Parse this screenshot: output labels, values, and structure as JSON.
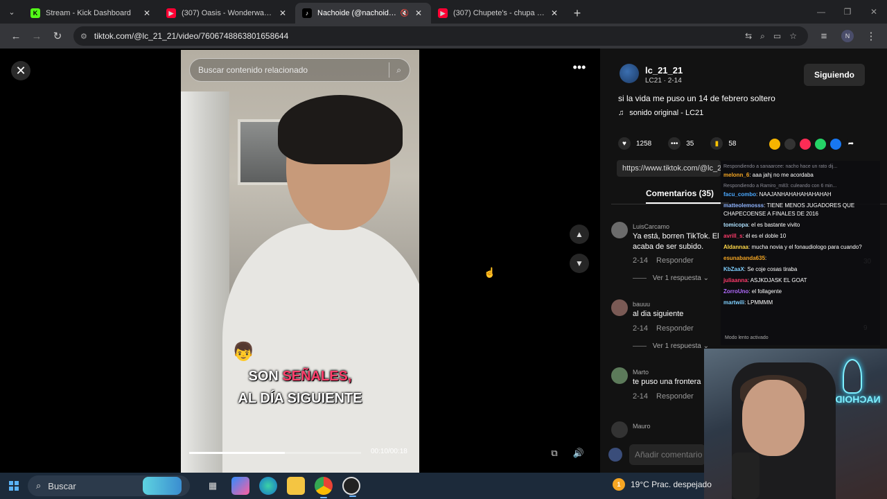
{
  "browser": {
    "tabs": [
      {
        "title": "Stream - Kick Dashboard",
        "favicon": "kick-icon",
        "color": "#53fc18",
        "active": false
      },
      {
        "title": "(307) Oasis - Wonderwall (Lyrics)",
        "favicon": "youtube-icon",
        "color": "#ff0033",
        "active": false
      },
      {
        "title": "Nachoide (@nachoide1) | TikTok",
        "favicon": "tiktok-icon",
        "color": "#000000",
        "active": true
      },
      {
        "title": "(307) Chupete's - chupa chupa chupa",
        "favicon": "youtube-icon",
        "color": "#ff0033",
        "active": false
      }
    ],
    "url": "tiktok.com/@lc_21_21/video/7606748863801658644",
    "profile_initial": "N"
  },
  "video": {
    "search_placeholder": "Buscar contenido relacionado",
    "caption_line1_a": "SON ",
    "caption_line1_b": "SEÑALES,",
    "caption_line2": "AL DÍA SIGUIENTE",
    "time": "00:10/00:18",
    "progress": 0.556
  },
  "post": {
    "username": "lc_21_21",
    "subtitle": "LC21 · 2-14",
    "follow_label": "Siguiendo",
    "description": "si la vida me puso un 14 de febrero soltero",
    "sound": "sonido original - LC21",
    "likes": "1258",
    "comments": "35",
    "saves": "58",
    "share_url": "https://www.tiktok.com/@lc_2",
    "comments_tab": "Comentarios (35)"
  },
  "comments": [
    {
      "user": "LuisCarcamo",
      "text": "Ya está, borren TikTok. El acaba de ser subido.",
      "date": "2-14",
      "reply": "Responder",
      "view_replies": "Ver 1 respuesta"
    },
    {
      "user": "bauuu",
      "text": "al dia siguiente",
      "date": "2-14",
      "reply": "Responder",
      "view_replies": "Ver 1 respuesta"
    },
    {
      "user": "Marto",
      "text": "te puso una frontera",
      "date": "2-14",
      "reply": "Responder"
    },
    {
      "user": "Mauro"
    }
  ],
  "side_numbers": [
    "30",
    "9"
  ],
  "add_comment_placeholder": "Añadir comentario",
  "chat": {
    "messages": [
      {
        "meta": "Respondiendo a sanaarcee: nacho hace un rato dij...",
        "user": "melonn_6",
        "color": "#f5a623",
        "text": ": aaa jahj no me acordaba"
      },
      {
        "meta": "Respondiendo a Ramiro_m83: culeando con 6 min...",
        "user": "facu_combo",
        "color": "#4aa8ff",
        "text": ": NAAJANHAHAHAHAHAHAH"
      },
      {
        "user": "matteolemosss",
        "color": "#8fb4ff",
        "text": ": TIENE MENOS JUGADORES QUE CHAPECOENSE A FINALES DE 2016"
      },
      {
        "user": "tomicopa",
        "color": "#aee1ff",
        "text": ": el es bastante vivito"
      },
      {
        "user": "avrill_s",
        "color": "#ff3b6b",
        "text": ": él es el doble 10"
      },
      {
        "user": "Aldannaa",
        "color": "#ffd84a",
        "text": ": mucha novia y el fonaudiologo para cuando?"
      },
      {
        "user": "esunabanda635",
        "color": "#f5a623",
        "text": ": "
      },
      {
        "user": "KbZaaX",
        "color": "#7fd0ff",
        "text": ": Se coje cosas tiraba"
      },
      {
        "user": "juliaanna",
        "color": "#ff3b6b",
        "text": ": ASJKDJASK EL GOAT"
      },
      {
        "user": "ZorroUno",
        "color": "#b36bff",
        "text": ": el follagente"
      },
      {
        "user": "martwili",
        "color": "#7fd0ff",
        "text": ": LPMMMM"
      }
    ],
    "footer": "Modo lento activado"
  },
  "webcam": {
    "neon_text": "NACHOIDE"
  },
  "taskbar": {
    "search_placeholder": "Buscar",
    "weather": "19°C  Prac. despejado",
    "weather_badge": "1"
  }
}
